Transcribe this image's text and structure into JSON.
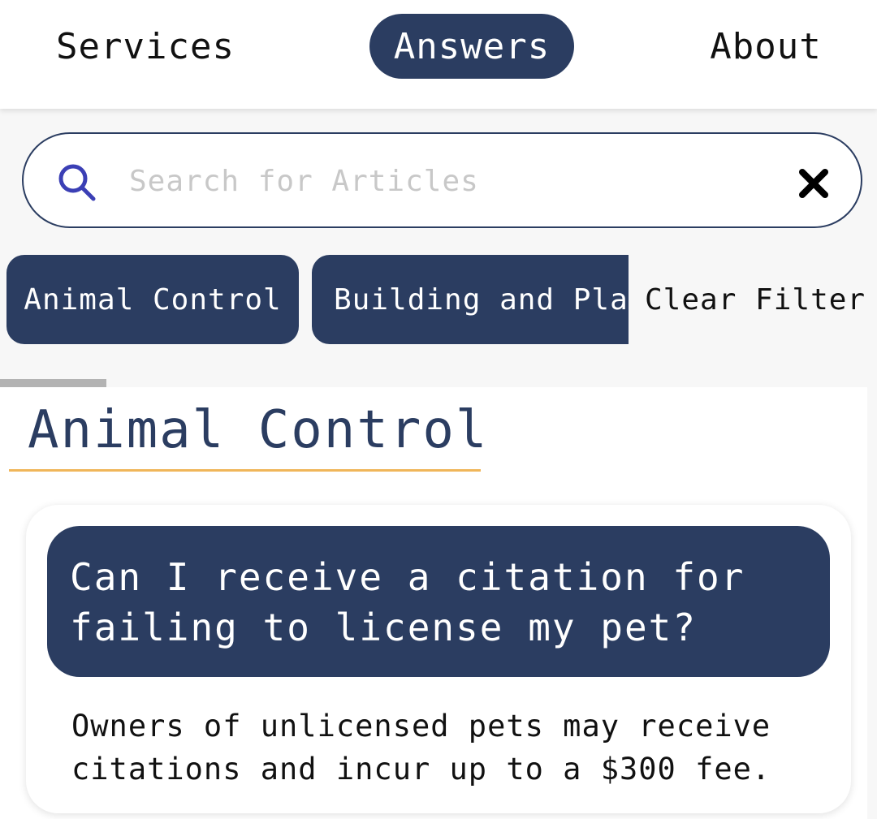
{
  "colors": {
    "navy": "#2b3d61",
    "accent_underline": "#f0b65a",
    "search_icon": "#3b3fb5"
  },
  "nav": {
    "items": [
      {
        "label": "Services",
        "active": false
      },
      {
        "label": "Answers",
        "active": true
      },
      {
        "label": "About",
        "active": false
      }
    ]
  },
  "search": {
    "placeholder": "Search for Articles",
    "value": "",
    "search_icon": "search-icon",
    "clear_icon": "close-icon"
  },
  "filters": {
    "chips": [
      "Animal Control",
      "Building and Planning"
    ],
    "clear_label": "Clear Filter"
  },
  "section": {
    "title": "Animal Control"
  },
  "articles": [
    {
      "question": "Can I receive a citation for failing to license my pet?",
      "answer": "Owners of unlicensed pets may receive citations and incur up to a $300 fee."
    }
  ]
}
